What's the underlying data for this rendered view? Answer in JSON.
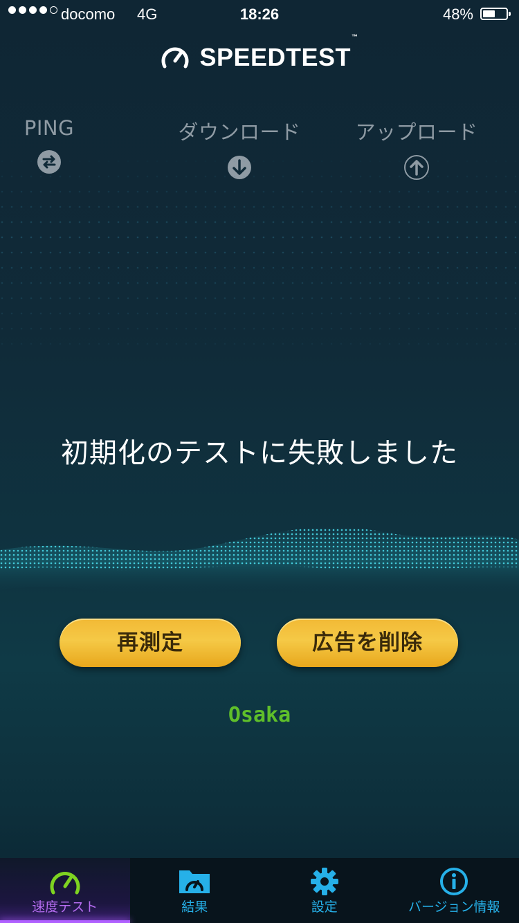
{
  "status_bar": {
    "carrier": "docomo",
    "network": "4G",
    "time": "18:26",
    "battery": "48%",
    "battery_level": 0.48,
    "signal_bars_filled": 4,
    "signal_bars_total": 5
  },
  "header": {
    "title": "SPEEDTEST",
    "tm": "™"
  },
  "metrics": {
    "ping": {
      "label": "PING",
      "icon": "ping-icon"
    },
    "download": {
      "label": "ダウンロード",
      "icon": "download-icon"
    },
    "upload": {
      "label": "アップロード",
      "icon": "upload-icon"
    }
  },
  "message": "初期化のテストに失敗しました",
  "buttons": {
    "retest": "再測定",
    "remove_ads": "広告を削除"
  },
  "server": "Osaka",
  "tabs": [
    {
      "label": "速度テスト",
      "icon": "speedometer-icon",
      "active": true
    },
    {
      "label": "結果",
      "icon": "results-folder-icon",
      "active": false
    },
    {
      "label": "設定",
      "icon": "gear-icon",
      "active": false
    },
    {
      "label": "バージョン情報",
      "icon": "info-icon",
      "active": false
    }
  ],
  "colors": {
    "accent_button": "#f2b935",
    "server_text": "#5fbf2a",
    "tab_text": "#26b0e8",
    "tab_active_text": "#b56cf0",
    "tab_active_icon": "#7ed321"
  }
}
